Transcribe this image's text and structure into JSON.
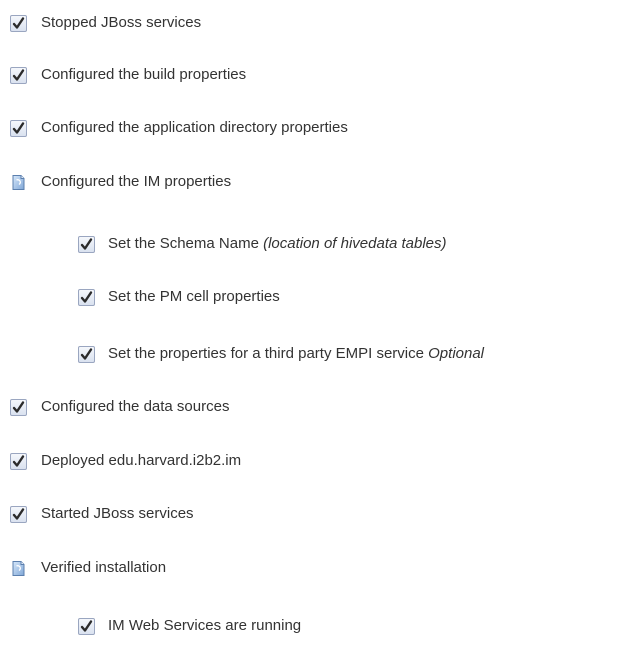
{
  "checklist": {
    "items": [
      {
        "icon": "checkmark-icon",
        "text": "Stopped JBoss services"
      },
      {
        "icon": "checkmark-icon",
        "text": "Configured the build properties"
      },
      {
        "icon": "checkmark-icon",
        "text": "Configured the application directory properties"
      },
      {
        "icon": "document-icon",
        "text": "Configured the IM properties"
      },
      {
        "icon": "checkmark-icon",
        "text": "Set the Schema Name ",
        "note": "(location of hivedata tables)"
      },
      {
        "icon": "checkmark-icon",
        "text": "Set the PM cell properties"
      },
      {
        "icon": "checkmark-icon",
        "text": "Set the properties for a third party EMPI service ",
        "note": "Optional"
      },
      {
        "icon": "checkmark-icon",
        "text": "Configured the data sources"
      },
      {
        "icon": "checkmark-icon",
        "text": "Deployed edu.harvard.i2b2.im"
      },
      {
        "icon": "checkmark-icon",
        "text": "Started JBoss services"
      },
      {
        "icon": "document-icon",
        "text": "Verified installation"
      },
      {
        "icon": "checkmark-icon",
        "text": "IM Web Services are running"
      }
    ]
  },
  "colors": {
    "text": "#333333",
    "check": "#2b2b2b",
    "box_fill": "#e9eef7",
    "box_border": "#9aa6c0",
    "doc_fill": "#a9c6e8",
    "doc_border": "#5b7fae"
  }
}
